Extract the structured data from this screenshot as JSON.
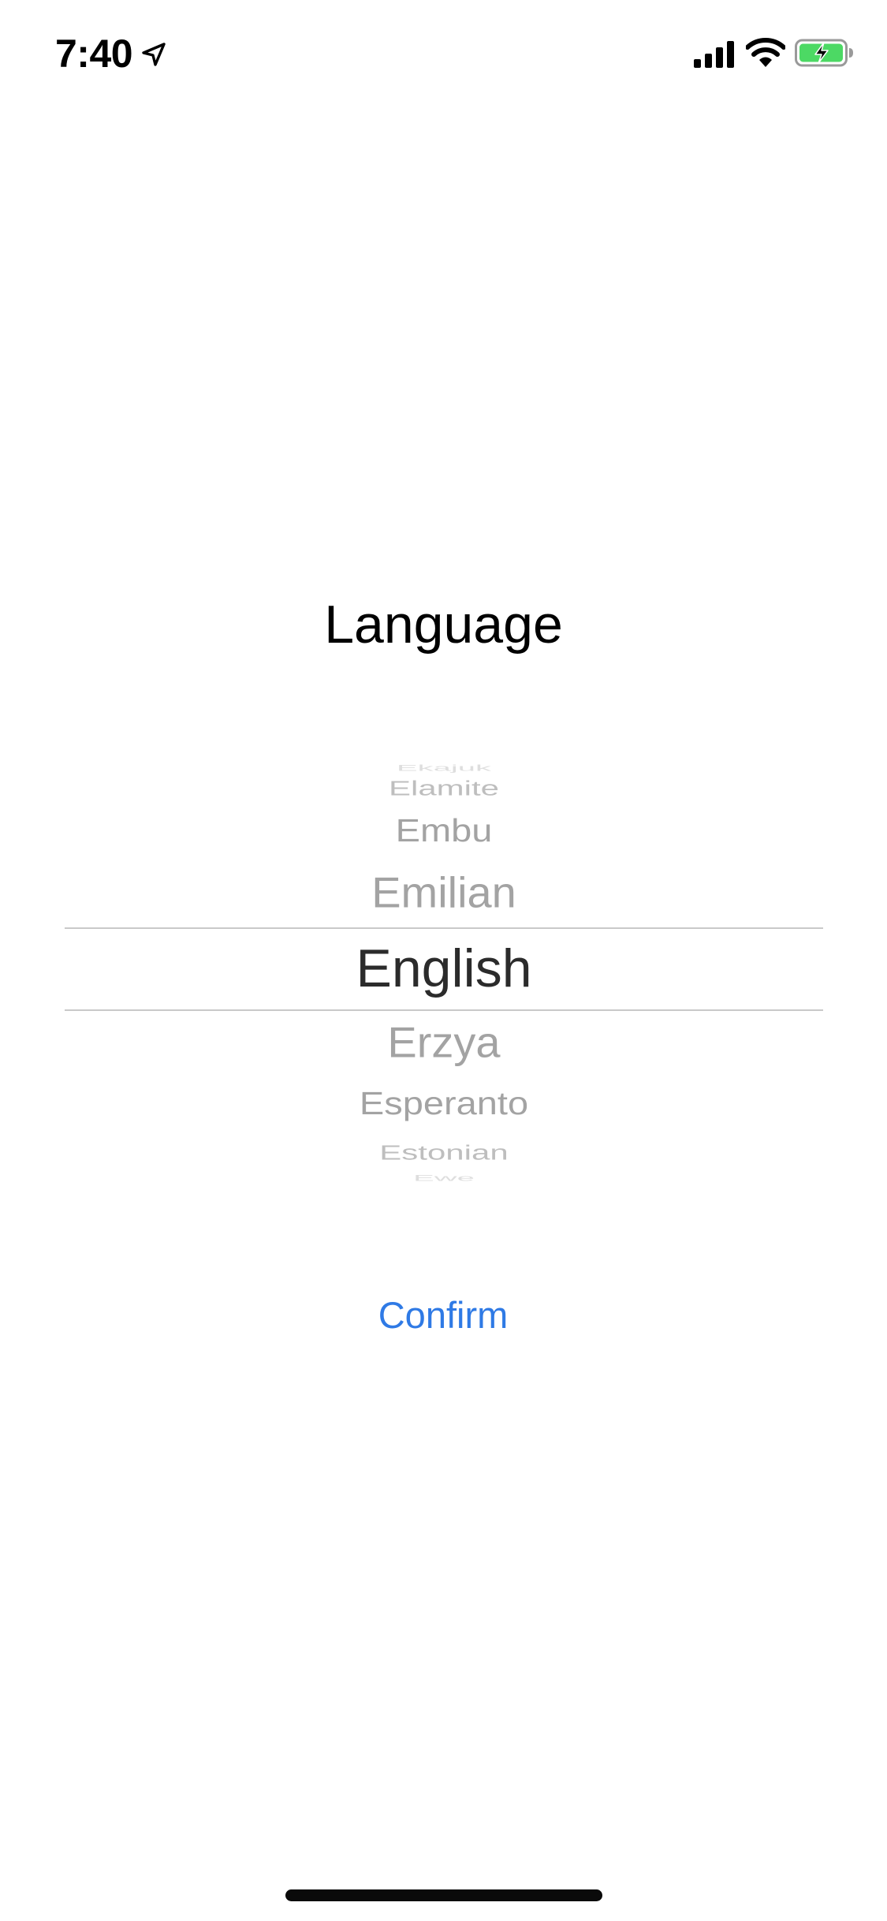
{
  "status_bar": {
    "time": "7:40",
    "location_icon": "location-arrow-icon",
    "signal_icon": "cellular-signal-icon",
    "wifi_icon": "wifi-icon",
    "battery_icon": "battery-charging-icon",
    "battery_color": "#4cd964"
  },
  "title": "Language",
  "picker": {
    "items": [
      "Ekajuk",
      "Elamite",
      "Embu",
      "Emilian",
      "English",
      "Erzya",
      "Esperanto",
      "Estonian",
      "Ewe"
    ],
    "selected": "English"
  },
  "confirm_label": "Confirm",
  "colors": {
    "accent": "#2f7ae5",
    "picker_dim": "#a3a3a3",
    "picker_selected": "#2b2b2b"
  }
}
